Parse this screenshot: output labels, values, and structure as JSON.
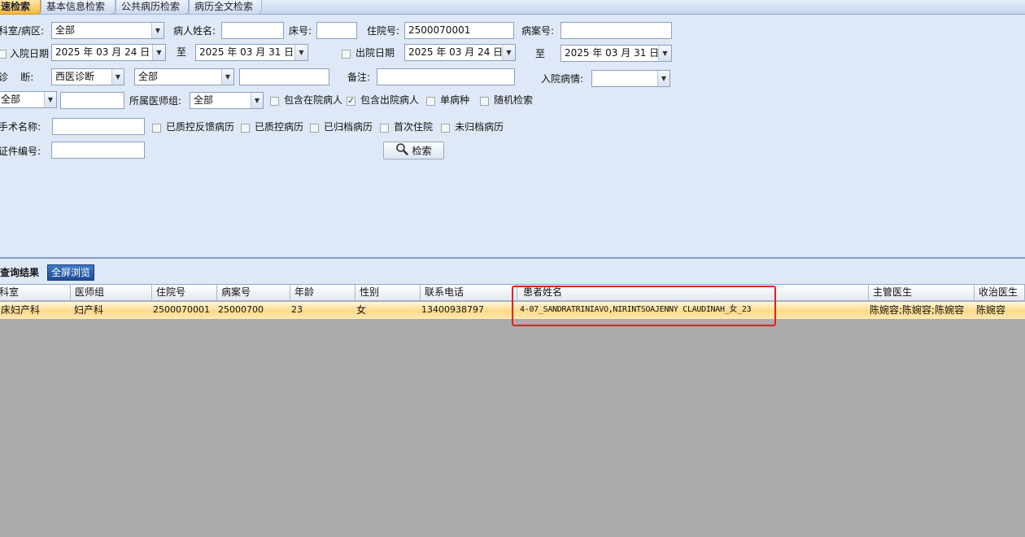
{
  "tabs": [
    "速检索",
    "基本信息检索",
    "公共病历检索",
    "病历全文检索"
  ],
  "form": {
    "dept_label": "科室/病区:",
    "dept_value": "全部",
    "patient_name_label": "病人姓名:",
    "bed_label": "床号:",
    "inpatient_no_label": "住院号:",
    "inpatient_no_value": "2500070001",
    "case_no_label": "病案号:",
    "admit_date_label": "入院日期",
    "admit_from": "2025 年 03 月 24 日",
    "to_label": "至",
    "admit_to": "2025 年 03 月 31 日",
    "discharge_date_label": "出院日期",
    "discharge_from": "2025 年 03 月 24 日",
    "discharge_to": "2025 年 03 月 31 日",
    "diag_label": "诊    断:",
    "diag_type": "西医诊断",
    "diag_scope": "全部",
    "remark_label": "备注:",
    "admit_condition_label": "入院病情:",
    "row4_combo": "全部",
    "doctor_group_label": "所属医师组:",
    "doctor_group_value": "全部",
    "cb_in_hospital": "包含在院病人",
    "cb_discharged": "包含出院病人",
    "cb_single_disease": "单病种",
    "cb_random": "随机检索",
    "surgery_label": "手术名称:",
    "cb_qc_feedback": "已质控反馈病历",
    "cb_qc": "已质控病历",
    "cb_archived": "已归档病历",
    "cb_first_admit": "首次住院",
    "cb_unarchived": "未归档病历",
    "id_no_label": "证件编号:",
    "search_button": "检索"
  },
  "results": {
    "tab_label": "查询结果",
    "fullscreen_label": "全屏浏览",
    "columns": [
      "科室",
      "医师组",
      "住院号",
      "病案号",
      "年龄",
      "性别",
      "联系电话",
      "患者姓名",
      "主管医生",
      "收治医生"
    ],
    "rows": [
      [
        "床妇产科",
        "妇产科",
        "2500070001",
        "25000700",
        "23",
        "女",
        "13400938797",
        "4-07_SANDRATRINIAVO,NIRINTSOAJENNY CLAUDINAH_女_23",
        "陈婉容;陈婉容;陈婉容",
        "陈婉容"
      ]
    ]
  },
  "colors": {
    "highlight_box": "#e02020",
    "selected_row": "#ffd98a",
    "panel_bg": "#dfe8f6"
  }
}
